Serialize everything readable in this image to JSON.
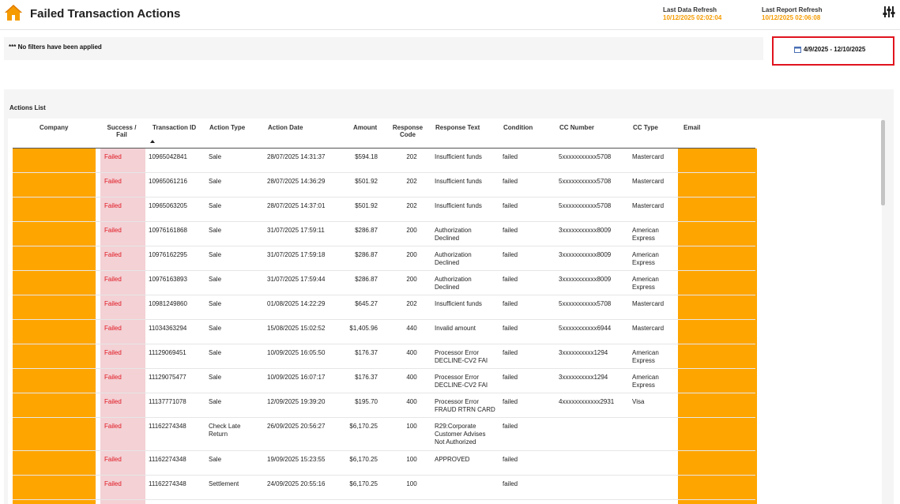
{
  "header": {
    "title": "Failed Transaction Actions",
    "data_refresh_label": "Last Data Refresh",
    "data_refresh_value": "10/12/2025 02:02:04",
    "report_refresh_label": "Last Report Refresh",
    "report_refresh_value": "10/12/2025 02:06:08"
  },
  "filters": {
    "text": "*** No filters have been applied"
  },
  "date_range": {
    "value": "4/9/2025 - 12/10/2025"
  },
  "list": {
    "title": "Actions List",
    "columns": {
      "company": "Company",
      "success_line1": "Success /",
      "success_line2": "Fail",
      "transaction_id": "Transaction ID",
      "action_type": "Action Type",
      "action_date": "Action Date",
      "amount": "Amount",
      "response_code_line1": "Response",
      "response_code_line2": "Code",
      "response_text": "Response Text",
      "condition": "Condition",
      "cc_number": "CC Number",
      "cc_type": "CC Type",
      "email": "Email"
    },
    "rows": [
      {
        "status": "Failed",
        "txn": "10965042841",
        "type": [
          "Sale"
        ],
        "date": "28/07/2025 14:31:37",
        "amount": "$594.18",
        "code": "202",
        "resp": [
          "Insufficient funds"
        ],
        "cond": "failed",
        "cc": "5xxxxxxxxxxx5708",
        "cctype": [
          "Mastercard"
        ]
      },
      {
        "status": "Failed",
        "txn": "10965061216",
        "type": [
          "Sale"
        ],
        "date": "28/07/2025 14:36:29",
        "amount": "$501.92",
        "code": "202",
        "resp": [
          "Insufficient funds"
        ],
        "cond": "failed",
        "cc": "5xxxxxxxxxxx5708",
        "cctype": [
          "Mastercard"
        ]
      },
      {
        "status": "Failed",
        "txn": "10965063205",
        "type": [
          "Sale"
        ],
        "date": "28/07/2025 14:37:01",
        "amount": "$501.92",
        "code": "202",
        "resp": [
          "Insufficient funds"
        ],
        "cond": "failed",
        "cc": "5xxxxxxxxxxx5708",
        "cctype": [
          "Mastercard"
        ]
      },
      {
        "status": "Failed",
        "txn": "10976161868",
        "type": [
          "Sale"
        ],
        "date": "31/07/2025 17:59:11",
        "amount": "$286.87",
        "code": "200",
        "resp": [
          "Authorization",
          "Declined"
        ],
        "cond": "failed",
        "cc": "3xxxxxxxxxxx8009",
        "cctype": [
          "American",
          "Express"
        ]
      },
      {
        "status": "Failed",
        "txn": "10976162295",
        "type": [
          "Sale"
        ],
        "date": "31/07/2025 17:59:18",
        "amount": "$286.87",
        "code": "200",
        "resp": [
          "Authorization",
          "Declined"
        ],
        "cond": "failed",
        "cc": "3xxxxxxxxxxx8009",
        "cctype": [
          "American",
          "Express"
        ]
      },
      {
        "status": "Failed",
        "txn": "10976163893",
        "type": [
          "Sale"
        ],
        "date": "31/07/2025 17:59:44",
        "amount": "$286.87",
        "code": "200",
        "resp": [
          "Authorization",
          "Declined"
        ],
        "cond": "failed",
        "cc": "3xxxxxxxxxxx8009",
        "cctype": [
          "American",
          "Express"
        ]
      },
      {
        "status": "Failed",
        "txn": "10981249860",
        "type": [
          "Sale"
        ],
        "date": "01/08/2025 14:22:29",
        "amount": "$645.27",
        "code": "202",
        "resp": [
          "Insufficient funds"
        ],
        "cond": "failed",
        "cc": "5xxxxxxxxxxx5708",
        "cctype": [
          "Mastercard"
        ]
      },
      {
        "status": "Failed",
        "txn": "11034363294",
        "type": [
          "Sale"
        ],
        "date": "15/08/2025 15:02:52",
        "amount": "$1,405.96",
        "code": "440",
        "resp": [
          "Invalid amount"
        ],
        "cond": "failed",
        "cc": "5xxxxxxxxxxx6944",
        "cctype": [
          "Mastercard"
        ]
      },
      {
        "status": "Failed",
        "txn": "11129069451",
        "type": [
          "Sale"
        ],
        "date": "10/09/2025 16:05:50",
        "amount": "$176.37",
        "code": "400",
        "resp": [
          "Processor Error",
          "DECLINE-CV2 FAI"
        ],
        "cond": "failed",
        "cc": "3xxxxxxxxxx1294",
        "cctype": [
          "American",
          "Express"
        ]
      },
      {
        "status": "Failed",
        "txn": "11129075477",
        "type": [
          "Sale"
        ],
        "date": "10/09/2025 16:07:17",
        "amount": "$176.37",
        "code": "400",
        "resp": [
          "Processor Error",
          "DECLINE-CV2 FAI"
        ],
        "cond": "failed",
        "cc": "3xxxxxxxxxx1294",
        "cctype": [
          "American",
          "Express"
        ]
      },
      {
        "status": "Failed",
        "txn": "11137771078",
        "type": [
          "Sale"
        ],
        "date": "12/09/2025 19:39:20",
        "amount": "$195.70",
        "code": "400",
        "resp": [
          "Processor Error",
          "FRAUD RTRN CARD"
        ],
        "cond": "failed",
        "cc": "4xxxxxxxxxxxx2931",
        "cctype": [
          "Visa"
        ]
      },
      {
        "status": "Failed",
        "txn": "11162274348",
        "type": [
          "Check Late",
          "Return"
        ],
        "date": "26/09/2025 20:56:27",
        "amount": "$6,170.25",
        "code": "100",
        "resp": [
          "R29:Corporate",
          "Customer Advises",
          "Not Authorized"
        ],
        "cond": "failed",
        "cc": "",
        "cctype": []
      },
      {
        "status": "Failed",
        "txn": "11162274348",
        "type": [
          "Sale"
        ],
        "date": "19/09/2025 15:23:55",
        "amount": "$6,170.25",
        "code": "100",
        "resp": [
          "APPROVED"
        ],
        "cond": "failed",
        "cc": "",
        "cctype": []
      },
      {
        "status": "Failed",
        "txn": "11162274348",
        "type": [
          "Settlement"
        ],
        "date": "24/09/2025 20:55:16",
        "amount": "$6,170.25",
        "code": "100",
        "resp": [],
        "cond": "failed",
        "cc": "",
        "cctype": []
      }
    ]
  },
  "colors": {
    "accent": "#f59b00",
    "fail": "#e0141e",
    "highlight": "#ffa500",
    "pink": "#f3d1d5"
  }
}
